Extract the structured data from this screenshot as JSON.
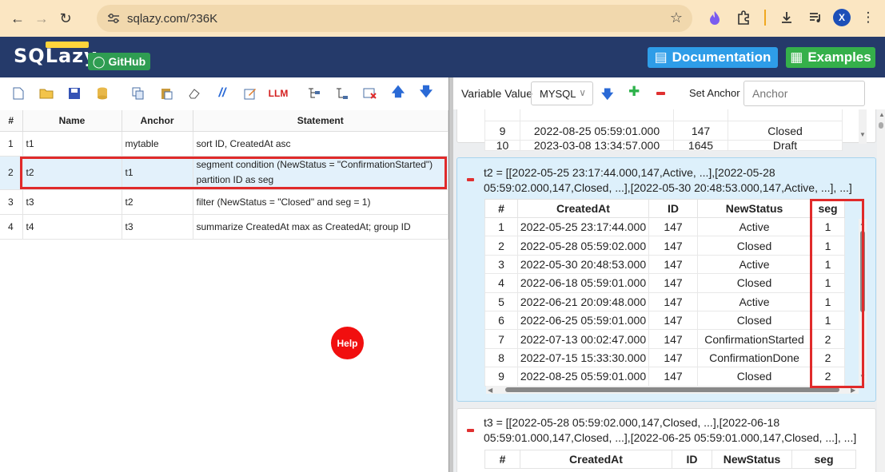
{
  "browser": {
    "url": "sqlazy.com/?36K",
    "profile_initial": "X"
  },
  "app": {
    "logo": "SQLazy",
    "github_label": "GitHub",
    "documentation_label": "Documentation",
    "examples_label": "Examples",
    "help_label": "Help",
    "llm_label": "LLM"
  },
  "left": {
    "columns": [
      "#",
      "Name",
      "Anchor",
      "Statement"
    ],
    "rows": [
      {
        "num": "1",
        "name": "t1",
        "anchor": "mytable",
        "statement": "sort ID, CreatedAt asc"
      },
      {
        "num": "2",
        "name": "t2",
        "anchor": "t1",
        "statement": "segment condition (NewStatus = \"ConfirmationStarted\") partition ID as seg"
      },
      {
        "num": "3",
        "name": "t3",
        "anchor": "t2",
        "statement": "filter (NewStatus = \"Closed\" and seg = 1)"
      },
      {
        "num": "4",
        "name": "t4",
        "anchor": "t3",
        "statement": "summarize CreatedAt max as CreatedAt; group ID"
      }
    ],
    "selected_row": 2
  },
  "right": {
    "variable_label": "Variable Value",
    "db_select": "MYSQL",
    "set_anchor_label": "Set Anchor",
    "anchor_placeholder": "Anchor",
    "top_table_rows": [
      {
        "n": "9",
        "created": "2022-08-25 05:59:01.000",
        "id": "147",
        "status": "Closed"
      },
      {
        "n": "10",
        "created": "2023-03-08 13:34:57.000",
        "id": "1645",
        "status": "Draft"
      }
    ],
    "t2": {
      "title": "t2 = [[2022-05-25 23:17:44.000,147,Active, ...],[2022-05-28 05:59:02.000,147,Closed, ...],[2022-05-30 20:48:53.000,147,Active, ...], ...]",
      "columns": [
        "#",
        "CreatedAt",
        "ID",
        "NewStatus",
        "seg"
      ],
      "rows": [
        {
          "n": "1",
          "created": "2022-05-25 23:17:44.000",
          "id": "147",
          "status": "Active",
          "seg": "1"
        },
        {
          "n": "2",
          "created": "2022-05-28 05:59:02.000",
          "id": "147",
          "status": "Closed",
          "seg": "1"
        },
        {
          "n": "3",
          "created": "2022-05-30 20:48:53.000",
          "id": "147",
          "status": "Active",
          "seg": "1"
        },
        {
          "n": "4",
          "created": "2022-06-18 05:59:01.000",
          "id": "147",
          "status": "Closed",
          "seg": "1"
        },
        {
          "n": "5",
          "created": "2022-06-21 20:09:48.000",
          "id": "147",
          "status": "Active",
          "seg": "1"
        },
        {
          "n": "6",
          "created": "2022-06-25 05:59:01.000",
          "id": "147",
          "status": "Closed",
          "seg": "1"
        },
        {
          "n": "7",
          "created": "2022-07-13 00:02:47.000",
          "id": "147",
          "status": "ConfirmationStarted",
          "seg": "2"
        },
        {
          "n": "8",
          "created": "2022-07-15 15:33:30.000",
          "id": "147",
          "status": "ConfirmationDone",
          "seg": "2"
        },
        {
          "n": "9",
          "created": "2022-08-25 05:59:01.000",
          "id": "147",
          "status": "Closed",
          "seg": "2"
        }
      ]
    },
    "t3": {
      "title": "t3 = [[2022-05-28 05:59:02.000,147,Closed, ...],[2022-06-18 05:59:01.000,147,Closed, ...],[2022-06-25 05:59:01.000,147,Closed, ...], ...]",
      "columns": [
        "#",
        "CreatedAt",
        "ID",
        "NewStatus",
        "seg"
      ]
    }
  }
}
